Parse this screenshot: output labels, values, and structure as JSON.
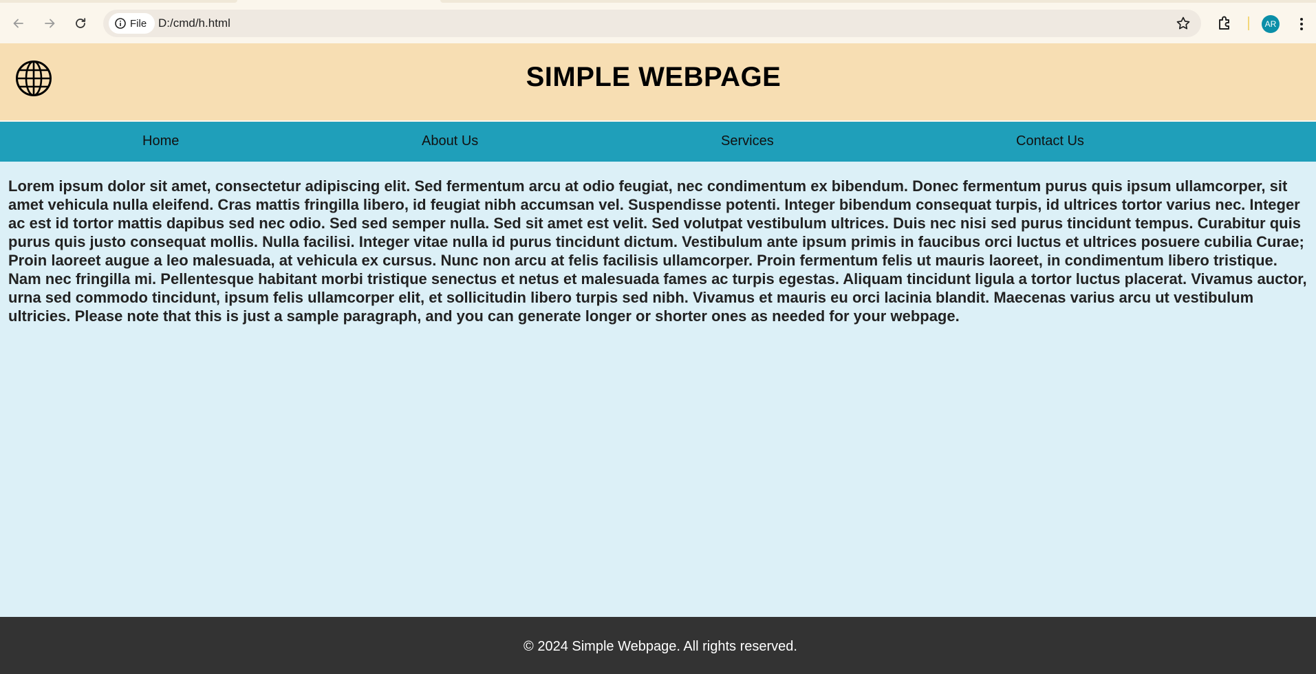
{
  "browser": {
    "site_chip_label": "File",
    "url": "D:/cmd/h.html",
    "profile_initials": "AR"
  },
  "header": {
    "title": "SIMPLE WEBPAGE"
  },
  "nav": {
    "home": "Home",
    "about": "About Us",
    "services": "Services",
    "contact": "Contact Us"
  },
  "main": {
    "paragraph": "Lorem ipsum dolor sit amet, consectetur adipiscing elit. Sed fermentum arcu at odio feugiat, nec condimentum ex bibendum. Donec fermentum purus quis ipsum ullamcorper, sit amet vehicula nulla eleifend. Cras mattis fringilla libero, id feugiat nibh accumsan vel. Suspendisse potenti. Integer bibendum consequat turpis, id ultrices tortor varius nec. Integer ac est id tortor mattis dapibus sed nec odio. Sed sed semper nulla. Sed sit amet est velit. Sed volutpat vestibulum ultrices. Duis nec nisi sed purus tincidunt tempus. Curabitur quis purus quis justo consequat mollis. Nulla facilisi. Integer vitae nulla id purus tincidunt dictum. Vestibulum ante ipsum primis in faucibus orci luctus et ultrices posuere cubilia Curae; Proin laoreet augue a leo malesuada, at vehicula ex cursus. Nunc non arcu at felis facilisis ullamcorper. Proin fermentum felis ut mauris laoreet, in condimentum libero tristique. Nam nec fringilla mi. Pellentesque habitant morbi tristique senectus et netus et malesuada fames ac turpis egestas. Aliquam tincidunt ligula a tortor luctus placerat. Vivamus auctor, urna sed commodo tincidunt, ipsum felis ullamcorper elit, et sollicitudin libero turpis sed nibh. Vivamus et mauris eu orci lacinia blandit. Maecenas varius arcu ut vestibulum ultricies. Please note that this is just a sample paragraph, and you can generate longer or shorter ones as needed for your webpage."
  },
  "footer": {
    "text": "© 2024 Simple Webpage. All rights reserved."
  },
  "colors": {
    "header_bg": "#f7deb3",
    "nav_bg": "#1f9fba",
    "content_bg": "#dcf0f7",
    "footer_bg": "#333333",
    "avatar_bg": "#0b8fa8"
  },
  "icons": {
    "back": "arrow-left-icon",
    "forward": "arrow-right-icon",
    "reload": "reload-icon",
    "site_info": "info-icon",
    "bookmark": "star-icon",
    "extensions": "puzzle-icon",
    "menu": "kebab-menu-icon",
    "logo": "globe-icon"
  }
}
